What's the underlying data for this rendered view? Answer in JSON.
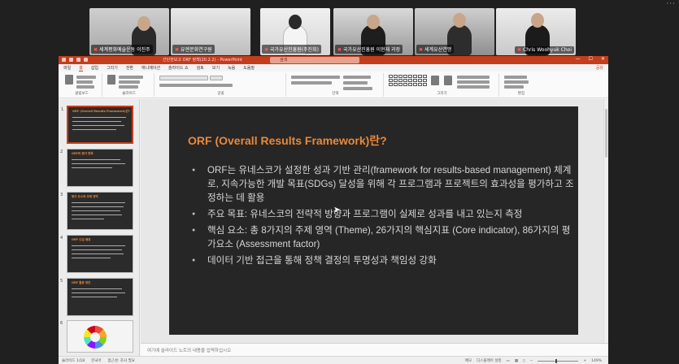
{
  "participants": [
    {
      "name": "세계평화예술운동 이진주",
      "active": false
    },
    {
      "name": "유엔문화연구원",
      "active": true
    },
    {
      "name": "국가유산진흥원(주진희)",
      "active": false
    },
    {
      "name": "국가유산진흥원 이현재 과장",
      "active": false
    },
    {
      "name": "세계유산연맹",
      "active": false
    },
    {
      "name": "Chris Woohyuk Choi",
      "active": false
    }
  ],
  "window": {
    "doc_title": "간단한보고 ORF 정책(20.2.2)  -  PowerPoint",
    "search_placeholder": "검색",
    "controls": [
      "—",
      "☐",
      "✕"
    ]
  },
  "ribbon": {
    "tabs": [
      "파일",
      "홈",
      "삽입",
      "그리기",
      "전환",
      "애니메이션",
      "슬라이드 쇼",
      "검토",
      "보기",
      "녹음",
      "도움말"
    ],
    "active_tab": "홈",
    "share_label": "공유",
    "groups": [
      "클립보드",
      "슬라이드",
      "글꼴",
      "단락",
      "그리기",
      "편집"
    ],
    "buttons": {
      "paste": "붙여넣기",
      "new_slide": "새 슬라이드",
      "arrange": "정렬",
      "quick_styles": "빠른 스타일",
      "find": "찾기",
      "replace": "바꾸기",
      "select": "선택"
    }
  },
  "thumbnails": [
    {
      "num": "1",
      "title": "ORF (Overall Results Framework)란?",
      "selected": true
    },
    {
      "num": "2",
      "title": "ORF의 평가 항목",
      "selected": false
    },
    {
      "num": "3",
      "title": "평가 요소와 주제 영역",
      "selected": false
    },
    {
      "num": "4",
      "title": "ORF 도입 배경",
      "selected": false
    },
    {
      "num": "5",
      "title": "ORF 활용 방안",
      "selected": false
    },
    {
      "num": "6",
      "title": "",
      "selected": false
    }
  ],
  "slide": {
    "title": "ORF (Overall Results Framework)란?",
    "bullets": [
      "ORF는 유네스코가 설정한 성과 기반 관리(framework for results-based management) 체계로, 지속가능한 개발 목표(SDGs) 달성을 위해 각 프로그램과 프로젝트의 효과성을 평가하고 조정하는 데 활용",
      "주요 목표: 유네스코의 전략적 방향과 프로그램이 실제로 성과를 내고 있는지 측정",
      "핵심 요소: 총 8가지의 주제 영역 (Theme), 26가지의 핵심지표 (Core indicator), 86가지의 평가요소 (Assessment factor)",
      "데이터 기반 접근을 통해 정책 결정의 투명성과 책임성 강화"
    ]
  },
  "notes_placeholder": "여기에 슬라이드 노트의 내용을 입력하십시오",
  "status": {
    "slide_counter": "슬라이드 1/18",
    "language": "한국어",
    "accessibility": "접근성: 조사 필요",
    "notes": "메모",
    "display": "디스플레이 설정",
    "zoom": "149%"
  }
}
